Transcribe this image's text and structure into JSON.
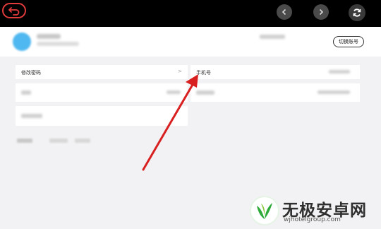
{
  "header": {
    "switch_account_label": "切换账号"
  },
  "settings": {
    "change_password_label": "修改密码",
    "change_password_chevron": ">",
    "phone_label": "手机号"
  },
  "watermark": {
    "brand": "无极安卓网",
    "url": "wjhotelgroup.com"
  },
  "colors": {
    "top_bar": "#000000",
    "back_border": "#e23b3b",
    "annotation_arrow": "#d92020",
    "avatar": "#4fb8f0",
    "logo_green": "#2eaa3a"
  },
  "icons": {
    "back": "back-arrow-icon",
    "prev": "chevron-left-icon",
    "next": "chevron-right-icon",
    "refresh": "refresh-icon"
  }
}
